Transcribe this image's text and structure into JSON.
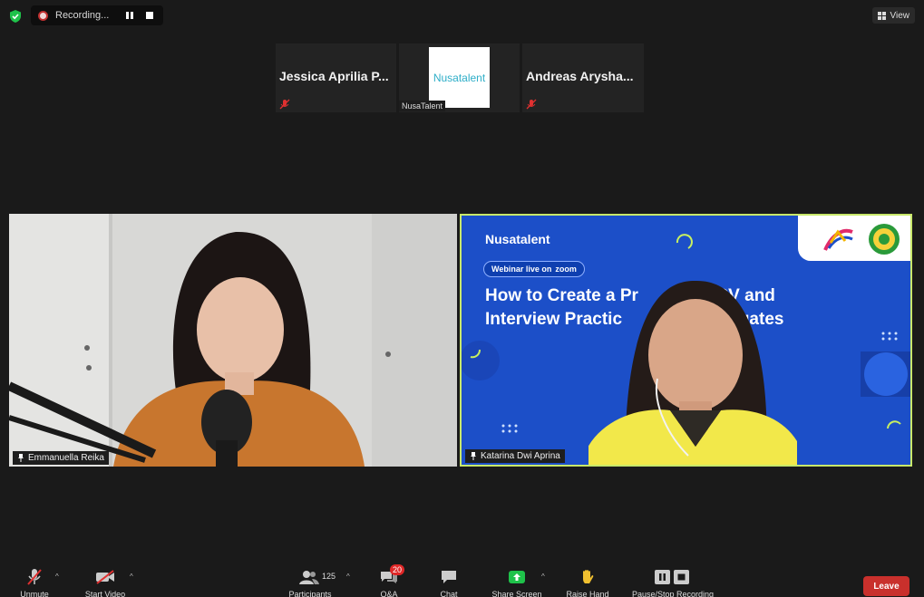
{
  "top_bar": {
    "recording_label": "Recording...",
    "view_label": "View"
  },
  "gallery": [
    {
      "name": "Jessica Aprilia P..."
    },
    {
      "name": "NusaTalent",
      "logo_text": "Nusatalent"
    },
    {
      "name": "Andreas Arysha..."
    }
  ],
  "videos": {
    "left": {
      "name": "Emmanuella Reika"
    },
    "right": {
      "name": "Katarina Dwi Aprina",
      "slide_brand": "Nusatalent",
      "slide_badge": "Webinar live on",
      "slide_badge_platform": "zoom",
      "slide_title_line1": "How to Create a Pr          nal CV and",
      "slide_title_line2": "Interview Practic                Graduates"
    }
  },
  "toolbar": {
    "unmute": "Unmute",
    "start_video": "Start Video",
    "participants": "Participants",
    "participant_count": "125",
    "qa": "Q&A",
    "qa_badge": "20",
    "chat": "Chat",
    "share_screen": "Share Screen",
    "raise_hand": "Raise Hand",
    "recording": "Pause/Stop Recording",
    "leave": "Leave"
  },
  "colors": {
    "active_speaker_border": "#c8e86a",
    "share_green": "#1fc24a",
    "leave_red": "#c9302c",
    "slide_blue": "#1c4fc8"
  }
}
